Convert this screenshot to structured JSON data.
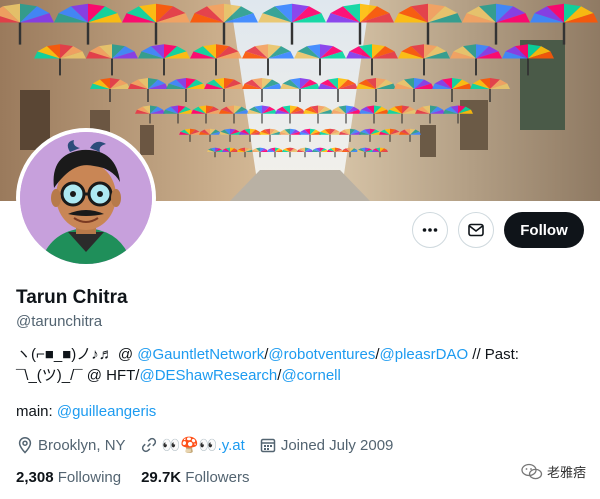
{
  "profile": {
    "name": "Tarun Chitra",
    "handle": "@tarunchitra"
  },
  "actions": {
    "more_icon": "more-icon",
    "message_icon": "mail-icon",
    "follow_label": "Follow"
  },
  "bio": {
    "line1_prefix": "ヽ(⌐■_■)ノ♪♬ @ ",
    "link_gauntlet": "@GauntletNetwork",
    "sep1": "/",
    "link_robot": "@robotventures",
    "sep2": "/",
    "link_pleasr": "@pleasrDAO",
    "past_label": " // Past:",
    "line2_prefix": "¯\\_(ツ)_/¯ @ HFT/",
    "link_deshaw": "@DEShawResearch",
    "sep3": "/",
    "link_cornell": "@cornell",
    "main_label": "main: ",
    "link_guille": "@guilleangeris"
  },
  "meta": {
    "location": "Brooklyn, NY",
    "website": "👀🍄👀.y.at",
    "joined": "Joined July 2009"
  },
  "stats": {
    "following_count": "2,308",
    "following_label": "Following",
    "followers_count": "29.7K",
    "followers_label": "Followers"
  },
  "watermark": {
    "text": "老雅痞"
  },
  "colors": {
    "link": "#1d9bf0",
    "text": "#0f1419",
    "muted": "#536471",
    "follow_bg": "#0f1419"
  }
}
